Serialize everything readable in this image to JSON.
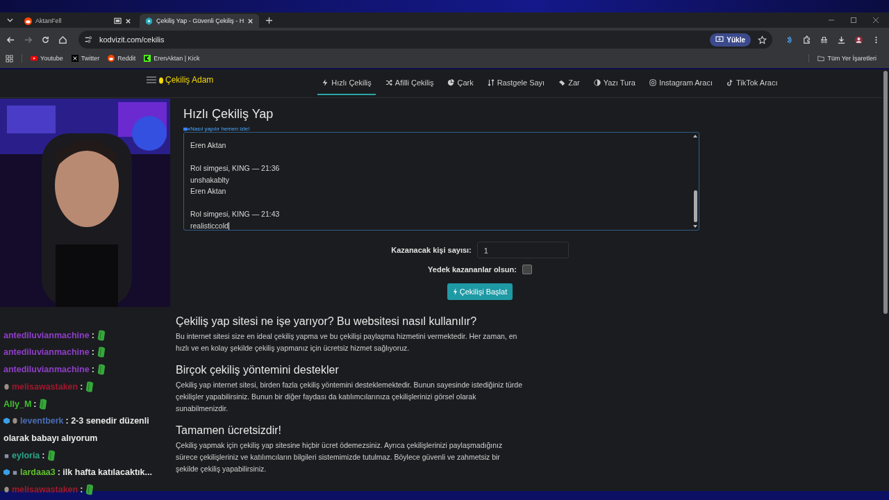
{
  "browser": {
    "tabs": [
      {
        "title": "AktanFell",
        "selected": false,
        "kind": "reddit"
      },
      {
        "title": "Çekiliş Yap - Güvenli Çekiliş - H",
        "selected": true,
        "kind": "site"
      }
    ],
    "url": "kodvizit.com/cekilis",
    "install_label": "Yükle",
    "bookmarks": [
      {
        "label": "Youtube",
        "kind": "youtube"
      },
      {
        "label": "Twitter",
        "kind": "x"
      },
      {
        "label": "Reddit",
        "kind": "reddit"
      },
      {
        "label": "ErenAktan | Kick",
        "kind": "kick"
      }
    ],
    "all_bookmarks": "Tüm Yer İşaretleri"
  },
  "site": {
    "brand": "Çekiliş Adam",
    "nav": [
      {
        "label": "Hızlı Çekiliş",
        "selected": true,
        "kind": "bolt"
      },
      {
        "label": "Afilli Çekiliş",
        "selected": false,
        "kind": "shuffle"
      },
      {
        "label": "Çark",
        "selected": false,
        "kind": "pie"
      },
      {
        "label": "Rastgele Sayı",
        "selected": false,
        "kind": "sort"
      },
      {
        "label": "Zar",
        "selected": false,
        "kind": "dice"
      },
      {
        "label": "Yazı Tura",
        "selected": false,
        "kind": "coin"
      },
      {
        "label": "Instagram Aracı",
        "selected": false,
        "kind": "instagram"
      },
      {
        "label": "TikTok Aracı",
        "selected": false,
        "kind": "tiktok"
      }
    ],
    "title": "Hızlı Çekiliş Yap",
    "video_link": "Nasıl yapılır hemen izle!",
    "entry_groups": [
      {
        "lines": [
          "Eren Aktan"
        ]
      },
      {
        "lines": [
          "Rol simgesi, KING — 21:36",
          "unshakablty",
          "Eren Aktan"
        ]
      },
      {
        "lines": [
          "Rol simgesi, KING — 21:43",
          "realisticcold"
        ]
      }
    ],
    "winners_label": "Kazanacak kişi sayısı:",
    "winners_value": "1",
    "backup_label": "Yedek kazananlar olsun:",
    "backup_checked": false,
    "start_button": "Çekilişi Başlat",
    "sections": [
      {
        "heading": "Çekiliş yap sitesi ne işe yarıyor? Bu websitesi nasıl kullanılır?",
        "text": "Bu internet sitesi size en ideal çekiliş yapma ve bu çekilişi paylaşma hizmetini vermektedir. Her zaman, en hızlı ve en kolay şekilde çekiliş yapmanız için ücretsiz hizmet sağlıyoruz."
      },
      {
        "heading": "Birçok çekiliş yöntemini destekler",
        "text": "Çekiliş yap internet sitesi, birden fazla çekiliş yöntemini desteklemektedir. Bunun sayesinde istediğiniz türde çekilişler yapabilirsiniz. Bunun bir diğer faydası da katılımcılarınıza çekilişlerinizi görsel olarak sunabilmenizdir."
      },
      {
        "heading": "Tamamen ücretsizdir!",
        "text": "Çekiliş yapmak için çekiliş yap sitesine hiçbir ücret ödemezsiniz. Ayrıca çekilişlerinizi paylaşmadığınız sürece çekilişleriniz ve katılımcıların bilgileri sistemimizde tutulmaz. Böylece güvenli ve zahmetsiz bir şekilde çekiliş yapabilirsiniz."
      }
    ]
  },
  "chat": [
    {
      "user": "antediluvianmachine",
      "color": "#8e3fc9",
      "separator": ":",
      "kind": "emote"
    },
    {
      "user": "antediluvianmachine",
      "color": "#8e3fc9",
      "separator": ":",
      "kind": "emote"
    },
    {
      "user": "antediluvianmachine",
      "color": "#8e3fc9",
      "separator": ":",
      "kind": "emote"
    },
    {
      "user": "melisawastaken",
      "color": "#a0182e",
      "badges": [
        {
          "kind": "mask"
        }
      ],
      "separator": ":",
      "kind": "emote"
    },
    {
      "user": "Ally_M",
      "color": "#3fc12c",
      "separator": ":",
      "kind": "emote"
    },
    {
      "user": "leventberk",
      "color": "#4a6cb5",
      "badges": [
        {
          "kind": "cube"
        },
        {
          "kind": "mask"
        }
      ],
      "separator": ":",
      "kind": "text",
      "text": "2-3 senedir düzenli",
      "continuation": "olarak babayı alıyorum"
    },
    {
      "user": "eyloria",
      "color": "#2aa58a",
      "badges": [
        {
          "kind": "hat"
        }
      ],
      "separator": ":",
      "kind": "emote"
    },
    {
      "user": "lardaaa3",
      "color": "#5fc02c",
      "badges": [
        {
          "kind": "cube"
        },
        {
          "kind": "hat"
        }
      ],
      "separator": ":",
      "kind": "text",
      "text": "ilk hafta katılacaktık..."
    },
    {
      "user": "melisawastaken",
      "color": "#a0182e",
      "badges": [
        {
          "kind": "mask"
        }
      ],
      "separator": ":",
      "kind": "emote"
    }
  ]
}
